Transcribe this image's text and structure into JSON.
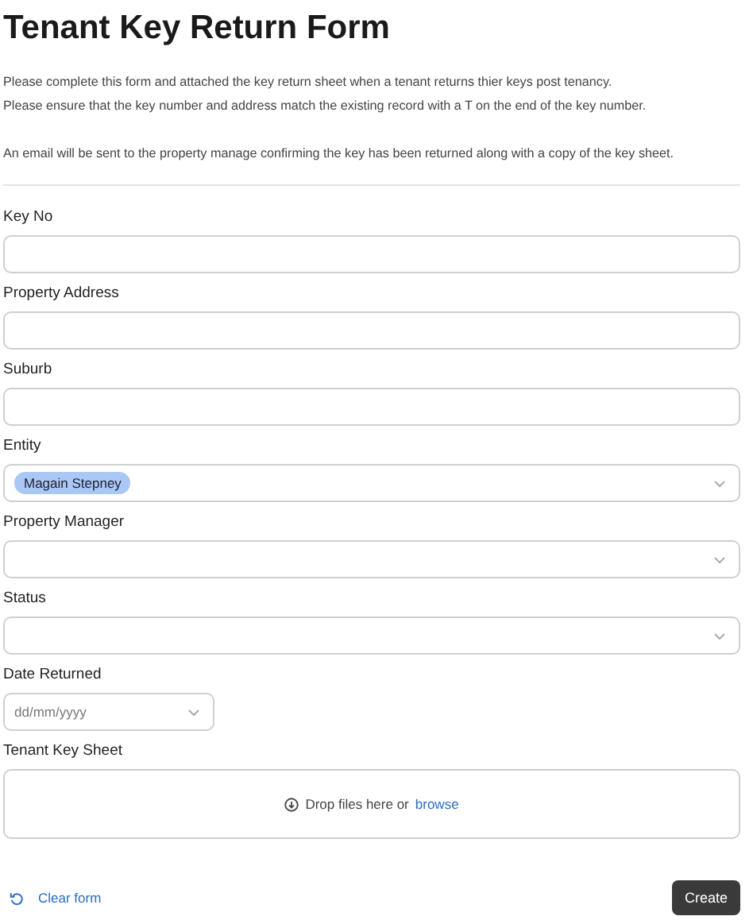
{
  "title": "Tenant Key Return Form",
  "intro": [
    "Please complete this form and attached the key return sheet when a tenant returns thier keys post tenancy.",
    "Please ensure that the key number and address match the existing record with a T on the end of the key number."
  ],
  "note": "An email will be sent to the property manage confirming the key has been returned along with a copy of the key sheet.",
  "fields": [
    {
      "kind": "text",
      "label": "Key No"
    },
    {
      "kind": "text",
      "label": "Property Address"
    },
    {
      "kind": "text",
      "label": "Suburb"
    },
    {
      "kind": "select",
      "label": "Entity",
      "chips": [
        "Magain Stepney"
      ]
    },
    {
      "kind": "select",
      "label": "Property Manager"
    },
    {
      "kind": "select",
      "label": "Status"
    },
    {
      "kind": "date",
      "label": "Date Returned",
      "placeholder": "dd/mm/yyyy"
    },
    {
      "kind": "file",
      "label": "Tenant Key Sheet",
      "drop_text": "Drop files here or",
      "browse": "browse"
    }
  ],
  "clear_button": "Clear form",
  "submit_button": "Create"
}
